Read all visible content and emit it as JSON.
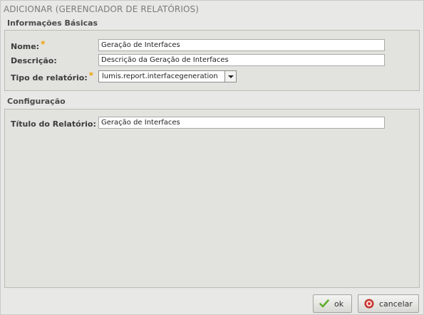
{
  "window": {
    "title": "ADICIONAR (GERENCIADOR DE RELATÓRIOS)"
  },
  "basic_info": {
    "heading": "Informações Básicas",
    "name_label": "Nome:",
    "name_value": "Geração de Interfaces",
    "description_label": "Descrição:",
    "description_value": "Descrição da Geração de Interfaces",
    "report_type_label": "Tipo de relatório:",
    "report_type_value": "lumis.report.interfacegeneration",
    "required_marker": "*"
  },
  "configuration": {
    "heading": "Configuração",
    "report_title_label": "Título do Relatório:",
    "report_title_value": "Geração de Interfaces"
  },
  "buttons": {
    "ok_label": "ok",
    "cancel_label": "cancelar"
  },
  "icons": {
    "ok": "checkmark-icon",
    "cancel": "cancel-circle-icon"
  },
  "colors": {
    "required": "#f0a000",
    "ok_icon": "#5fae2e",
    "cancel_icon": "#d8403a"
  }
}
